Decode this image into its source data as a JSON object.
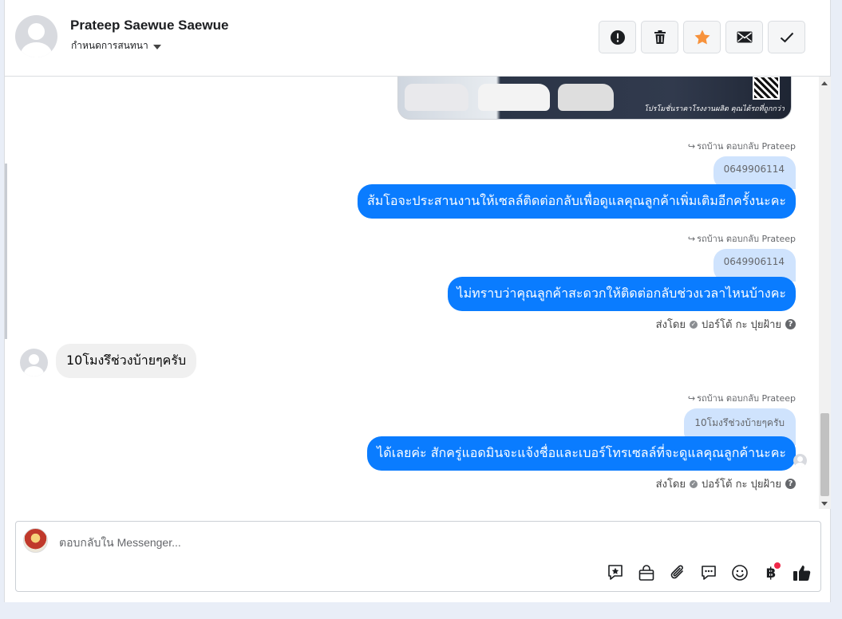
{
  "header": {
    "contact_name": "Prateep Saewue Saewue",
    "assign_label": "กำหนดการสนทนา"
  },
  "actions": [
    {
      "name": "spam-button",
      "icon": "alert-icon"
    },
    {
      "name": "delete-button",
      "icon": "trash-icon"
    },
    {
      "name": "star-button",
      "icon": "star-icon",
      "color": "#f7923b"
    },
    {
      "name": "mark-unread-button",
      "icon": "mail-icon"
    },
    {
      "name": "done-button",
      "icon": "check-icon"
    }
  ],
  "messages": {
    "image_caption": "โปรโมชั่นราคาโรงงานผลิต คุณได้รถที่ถูกกว่า",
    "m1": {
      "reply_note": "รถบ้าน ตอบกลับ Prateep",
      "quote": "0649906114",
      "text": "ส้มโอจะประสานงานให้เซลล์ติดต่อกลับเพื่อดูแลคุณลูกค้าเพิ่มเติมอีกครั้งนะคะ"
    },
    "m2": {
      "reply_note": "รถบ้าน ตอบกลับ Prateep",
      "quote": "0649906114",
      "text": "ไม่ทราบว่าคุณลูกค้าสะดวกให้ติดต่อกลับช่วงเวลาไหนบ้างคะ",
      "sent_by_label": "ส่งโดย",
      "sender": "ปอร์โต้ กะ ปุยฝ้าย"
    },
    "incoming": {
      "text": "10โมงรึช่วงบ้ายๆครับ"
    },
    "m3": {
      "reply_note": "รถบ้าน ตอบกลับ Prateep",
      "quote": "10โมงรึช่วงบ้ายๆครับ",
      "text": "ได้เลยค่ะ สักครู่แอดมินจะแจ้งชื่อและเบอร์โทรเซลล์ที่จะดูแลคุณลูกค้านะคะ",
      "sent_by_label": "ส่งโดย",
      "sender": "ปอร์โต้ กะ ปุยฝ้าย"
    }
  },
  "composer": {
    "placeholder": "ตอบกลับใน Messenger...",
    "tools": [
      "sticker-star-icon",
      "shop-bag-icon",
      "paperclip-icon",
      "saved-replies-icon",
      "emoji-icon",
      "baht-payment-icon",
      "thumbs-up-icon"
    ]
  },
  "colors": {
    "outgoing_bubble": "#0a7cff",
    "quote_bubble": "#cfe3fd",
    "incoming_bubble": "#f0f0f0",
    "notification_dot": "#f02849"
  }
}
